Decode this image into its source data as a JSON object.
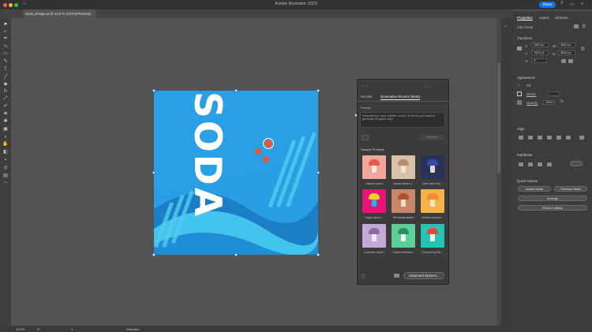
{
  "app": {
    "title": "Adobe Illustrator 2023",
    "share": "Share"
  },
  "document": {
    "tab": "Soda_Design.ai @ 12.5 % (CMYK/Preview)"
  },
  "artwork": {
    "text": "SODA",
    "bg_color": "#2a9ee2"
  },
  "recolor": {
    "tabs": [
      "Recolor",
      "Generative Recolor (Beta)"
    ],
    "prompt_label": "Prompt",
    "prompt_text": "Describe the color palette, mood, or theme you want to generate (English only)",
    "generate": "Generate",
    "samples_label": "Sample Prompts",
    "samples": [
      {
        "label": "Salmon sushi",
        "bg": "#f2a59a",
        "cap": "#e35d4a",
        "stem": "#f7e8d8"
      },
      {
        "label": "Sandy stone b...",
        "bg": "#d8c1a8",
        "cap": "#b58f6c",
        "stem": "#efe1cf"
      },
      {
        "label": "Dark blue nich...",
        "bg": "#2a315a",
        "cap": "#3b4aa3",
        "stem": "#e0d9d0"
      },
      {
        "label": "Trippy disco f...",
        "bg": "#e8147a",
        "cap": "#f4d022",
        "stem": "#22b5e0"
      },
      {
        "label": "Terracotta desert",
        "bg": "#c9876a",
        "cap": "#b25034",
        "stem": "#f1dcc5"
      },
      {
        "label": "Mellow summer...",
        "bg": "#f4b24a",
        "cap": "#f28a2e",
        "stem": "#fbe7c4"
      },
      {
        "label": "Lavender storm",
        "bg": "#c4a9d6",
        "cap": "#8e6aa8",
        "stem": "#f2e8f4"
      },
      {
        "label": "Faded emerald...",
        "bg": "#5fcf9a",
        "cap": "#2e8f63",
        "stem": "#e9f7ef"
      },
      {
        "label": "Summer by the...",
        "bg": "#23c6b4",
        "cap": "#e24a3b",
        "stem": "#fff5e6"
      }
    ],
    "advanced": "Advanced Options..."
  },
  "panel": {
    "tabs": [
      "Properties",
      "Layers",
      "Libraries"
    ],
    "clip_group": "Clip Group",
    "transform": "Transform",
    "x": "1920 px",
    "y": "1920 px",
    "w": "3840 px",
    "h": "3840 px",
    "angle": "0°",
    "appearance": "Appearance",
    "fill": "Fill",
    "stroke": "Stroke",
    "opacity_label": "Opacity",
    "opacity": "100%",
    "align": "Align",
    "pathfinder": "Pathfinder",
    "quick_actions": "Quick Actions",
    "isolate_mask": "Isolate Mask",
    "release_mask": "Release Mask",
    "arrange": "Arrange",
    "recolor_beta": "Recolor (Beta)"
  },
  "status": {
    "zoom": "12.5%",
    "angle": "0°",
    "page": "1",
    "tool": "Selection"
  }
}
